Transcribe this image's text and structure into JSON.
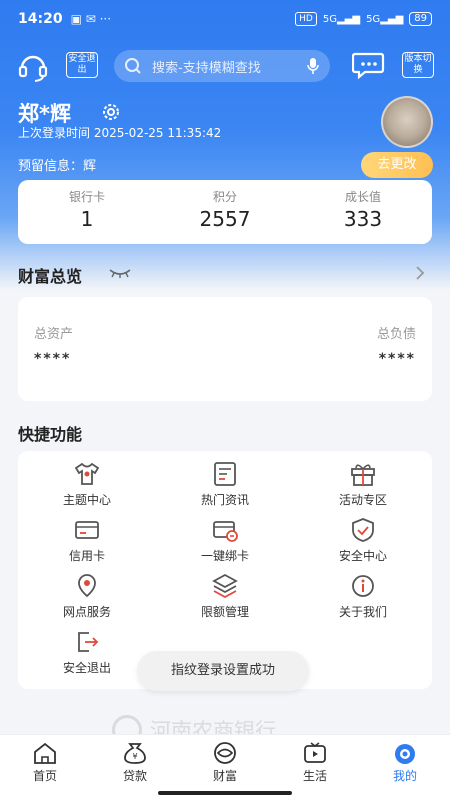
{
  "status_bar": {
    "time": "14:20",
    "right_chip": "HD",
    "signal_1": "5G",
    "signal_2": "5G",
    "battery": "89"
  },
  "toolbar": {
    "logout_label": "安全退出",
    "search_placeholder": "搜索-支持模糊查找",
    "version_label": "版本切换"
  },
  "profile": {
    "name": "郑*辉",
    "last_login": "上次登录时间 2025-02-25 11:35:42",
    "reserved_info": "预留信息：辉",
    "change_button": "去更改"
  },
  "stats": [
    {
      "label": "银行卡",
      "value": "1"
    },
    {
      "label": "积分",
      "value": "2557"
    },
    {
      "label": "成长值",
      "value": "333"
    }
  ],
  "wealth": {
    "title": "财富总览",
    "total_assets_label": "总资产",
    "total_assets_value": "****",
    "total_debt_label": "总负债",
    "total_debt_value": "****"
  },
  "quick": {
    "title": "快捷功能",
    "items": [
      {
        "label": "主题中心",
        "icon": "shirt-icon"
      },
      {
        "label": "热门资讯",
        "icon": "news-icon"
      },
      {
        "label": "活动专区",
        "icon": "gift-icon"
      },
      {
        "label": "信用卡",
        "icon": "credit-card-icon"
      },
      {
        "label": "一键绑卡",
        "icon": "bind-card-icon"
      },
      {
        "label": "安全中心",
        "icon": "shield-icon"
      },
      {
        "label": "网点服务",
        "icon": "location-icon"
      },
      {
        "label": "限额管理",
        "icon": "layers-icon"
      },
      {
        "label": "关于我们",
        "icon": "info-icon"
      },
      {
        "label": "安全退出",
        "icon": "logout-icon"
      }
    ]
  },
  "toast": "指纹登录设置成功",
  "bank_name": "河南农商银行",
  "tabs": [
    {
      "label": "首页",
      "icon": "home-icon"
    },
    {
      "label": "贷款",
      "icon": "loan-icon"
    },
    {
      "label": "财富",
      "icon": "wealth-icon"
    },
    {
      "label": "生活",
      "icon": "life-icon"
    },
    {
      "label": "我的",
      "icon": "me-icon",
      "active": true
    }
  ],
  "colors": {
    "primary": "#2f7bf0",
    "accent": "#ffbf52"
  }
}
